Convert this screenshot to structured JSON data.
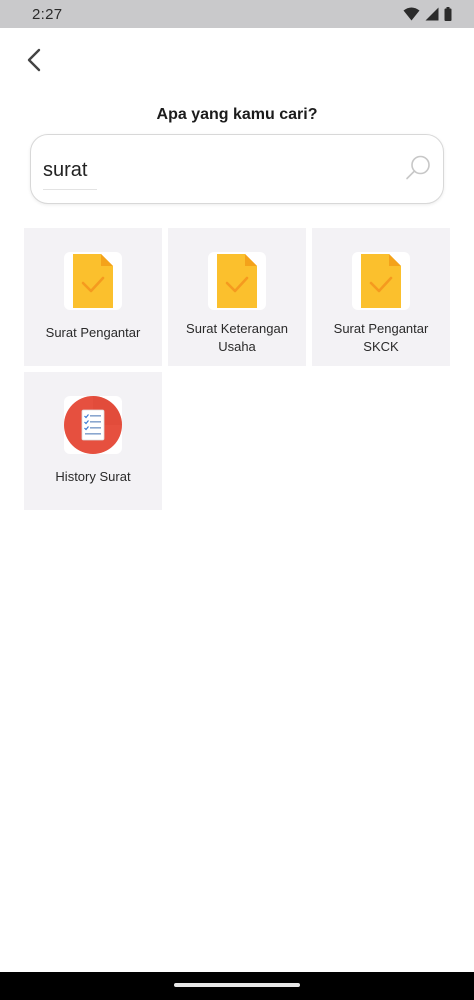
{
  "status_bar": {
    "time": "2:27"
  },
  "header": {
    "title": "Apa yang kamu cari?"
  },
  "search": {
    "value": "surat"
  },
  "results": [
    {
      "label": "Surat Pengantar",
      "icon": "document-check-icon"
    },
    {
      "label": "Surat Keterangan Usaha",
      "icon": "document-check-icon"
    },
    {
      "label": "Surat Pengantar SKCK",
      "icon": "document-check-icon"
    },
    {
      "label": "History Surat",
      "icon": "history-document-icon"
    }
  ],
  "colors": {
    "doc_yellow": "#fbc02d",
    "doc_fold": "#f4a21a",
    "check": "#f59a1f",
    "history_red": "#e6503f",
    "card_bg": "#f3f2f5"
  }
}
